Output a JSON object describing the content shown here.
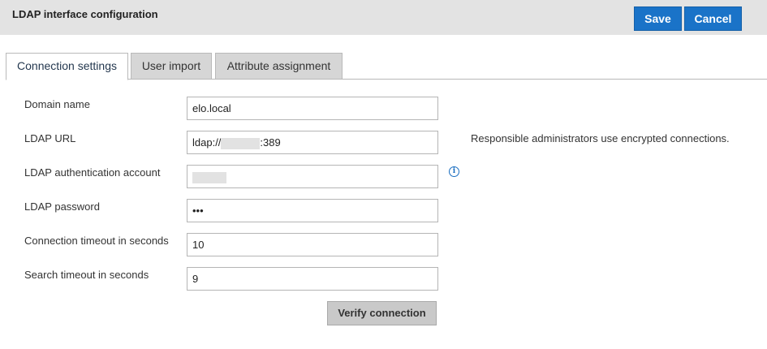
{
  "header": {
    "title": "LDAP interface configuration",
    "save_label": "Save",
    "cancel_label": "Cancel"
  },
  "tabs": [
    {
      "label": "Connection settings",
      "active": true
    },
    {
      "label": "User import",
      "active": false
    },
    {
      "label": "Attribute assignment",
      "active": false
    }
  ],
  "form": {
    "domain_name": {
      "label": "Domain name",
      "value": "elo.local"
    },
    "ldap_url": {
      "label": "LDAP URL",
      "prefix": "ldap://",
      "suffix": ":389"
    },
    "auth_account": {
      "label": "LDAP authentication account"
    },
    "password": {
      "label": "LDAP password",
      "value": "•••"
    },
    "connection_timeout": {
      "label": "Connection timeout in seconds",
      "value": "10"
    },
    "search_timeout": {
      "label": "Search timeout in seconds",
      "value": "9"
    },
    "verify_label": "Verify connection"
  },
  "note": "Responsible administrators use encrypted connections.",
  "icons": {
    "info": "info-icon"
  },
  "colors": {
    "accent": "#1a73c8",
    "header_bg": "#e3e3e3",
    "tab_inactive_bg": "#d6d6d6",
    "verify_bg": "#c9c9c9"
  }
}
